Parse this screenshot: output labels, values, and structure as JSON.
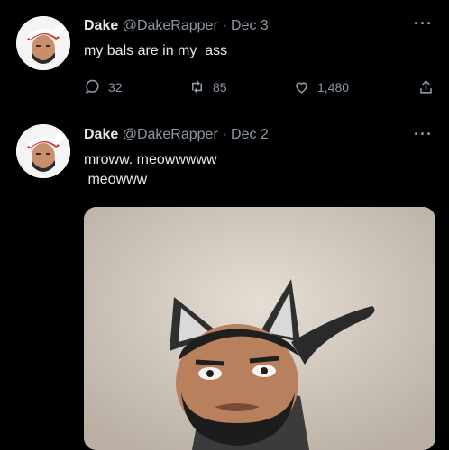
{
  "tweets": [
    {
      "author_name": "Dake",
      "handle": "@DakeRapper",
      "separator": "·",
      "date": "Dec 3",
      "text": "my bals are in my  ass",
      "stats": {
        "replies": "32",
        "retweets": "85",
        "likes": "1,480"
      },
      "more_icon": "more-dots-icon",
      "avatar_icon": "santa-hat-avatar"
    },
    {
      "author_name": "Dake",
      "handle": "@DakeRapper",
      "separator": "·",
      "date": "Dec 2",
      "text": "mroww. meowwwww\n meowww",
      "more_icon": "more-dots-icon",
      "avatar_icon": "santa-hat-avatar",
      "media_icon": "cat-ear-rapper-photo"
    }
  ],
  "colors": {
    "background": "#000000",
    "text": "#e7e9ea",
    "secondary": "#8b98a5",
    "divider": "#2f3336",
    "hat": "#d0312d"
  }
}
